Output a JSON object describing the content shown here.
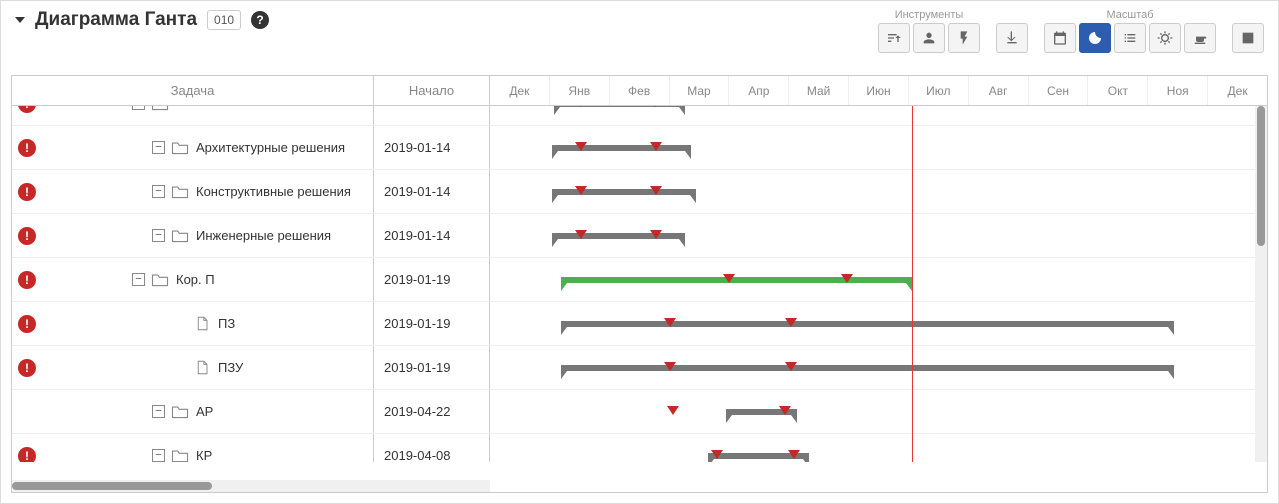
{
  "header": {
    "title": "Диаграмма Ганта",
    "badge": "010",
    "tools_label": "Инструменты",
    "scale_label": "Масштаб"
  },
  "columns": {
    "task": "Задача",
    "start": "Начало"
  },
  "months": [
    "Дек",
    "Янв",
    "Фев",
    "Мар",
    "Апр",
    "Май",
    "Июн",
    "Июл",
    "Авг",
    "Сен",
    "Окт",
    "Ноя",
    "Дек"
  ],
  "today_month_index": 7.15,
  "rows": [
    {
      "alert": true,
      "indent": 88,
      "toggle": true,
      "icon": "folder",
      "name": "",
      "start": "",
      "bar": {
        "type": "gray",
        "from": 1.08,
        "to": 3.3,
        "markers": [
          1.55,
          2.8
        ]
      },
      "partial_top": true
    },
    {
      "alert": true,
      "indent": 108,
      "toggle": true,
      "icon": "folder",
      "name": "Архитектурные решения",
      "start": "2019-01-14",
      "bar": {
        "type": "gray",
        "from": 1.05,
        "to": 3.4,
        "markers": [
          1.55,
          2.82
        ]
      }
    },
    {
      "alert": true,
      "indent": 108,
      "toggle": true,
      "icon": "folder",
      "name": "Конструктивные решения",
      "start": "2019-01-14",
      "bar": {
        "type": "gray",
        "from": 1.05,
        "to": 3.5,
        "markers": [
          1.55,
          2.82
        ]
      }
    },
    {
      "alert": true,
      "indent": 108,
      "toggle": true,
      "icon": "folder",
      "name": "Инженерные решения",
      "start": "2019-01-14",
      "bar": {
        "type": "gray",
        "from": 1.05,
        "to": 3.3,
        "markers": [
          1.55,
          2.82
        ]
      }
    },
    {
      "alert": true,
      "indent": 88,
      "toggle": true,
      "icon": "folder",
      "name": "Кор. П",
      "start": "2019-01-19",
      "bar": {
        "type": "green",
        "from": 1.2,
        "to": 7.15,
        "markers": [
          4.05,
          6.05
        ]
      }
    },
    {
      "alert": true,
      "indent": 130,
      "toggle": false,
      "icon": "file",
      "name": "ПЗ",
      "start": "2019-01-19",
      "bar": {
        "type": "gray",
        "from": 1.2,
        "to": 11.6,
        "markers": [
          3.05,
          5.1
        ]
      }
    },
    {
      "alert": true,
      "indent": 130,
      "toggle": false,
      "icon": "file",
      "name": "ПЗУ",
      "start": "2019-01-19",
      "bar": {
        "type": "gray",
        "from": 1.2,
        "to": 11.6,
        "markers": [
          3.05,
          5.1
        ]
      }
    },
    {
      "alert": false,
      "indent": 108,
      "toggle": true,
      "icon": "folder",
      "name": "АР",
      "start": "2019-04-22",
      "bar": {
        "type": "gray",
        "from": 4.0,
        "to": 5.2,
        "markers": [
          3.1,
          5.0
        ]
      }
    },
    {
      "alert": true,
      "indent": 108,
      "toggle": true,
      "icon": "folder",
      "name": "КР",
      "start": "2019-04-08",
      "bar": {
        "type": "gray",
        "from": 3.7,
        "to": 5.4,
        "markers": [
          3.85,
          5.15
        ]
      }
    }
  ]
}
